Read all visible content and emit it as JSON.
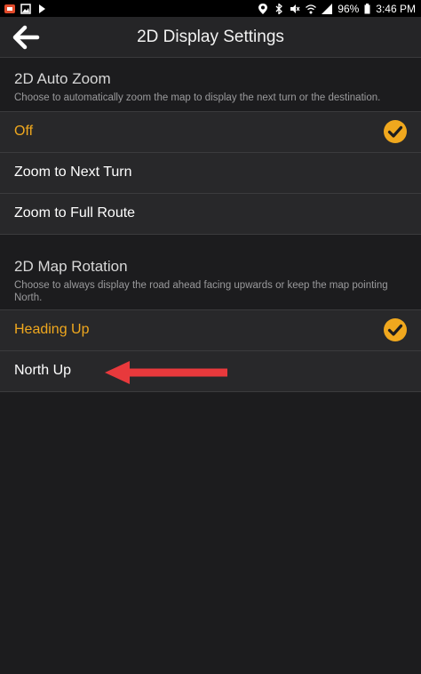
{
  "status_bar": {
    "battery": "96%",
    "time": "3:46 PM"
  },
  "header": {
    "title": "2D Display Settings"
  },
  "auto_zoom": {
    "title": "2D Auto Zoom",
    "description": "Choose to automatically zoom the map to display the next turn or the destination.",
    "options": [
      {
        "label": "Off",
        "selected": true
      },
      {
        "label": "Zoom to Next Turn",
        "selected": false
      },
      {
        "label": "Zoom to Full Route",
        "selected": false
      }
    ]
  },
  "map_rotation": {
    "title": "2D Map Rotation",
    "description": "Choose to always display the road ahead facing upwards or keep the map pointing North.",
    "options": [
      {
        "label": "Heading Up",
        "selected": true
      },
      {
        "label": "North Up",
        "selected": false
      }
    ]
  },
  "colors": {
    "accent": "#f0a81e",
    "annotation_arrow": "#e8393c",
    "row_background": "#28282a",
    "page_background": "#1c1c1e"
  }
}
